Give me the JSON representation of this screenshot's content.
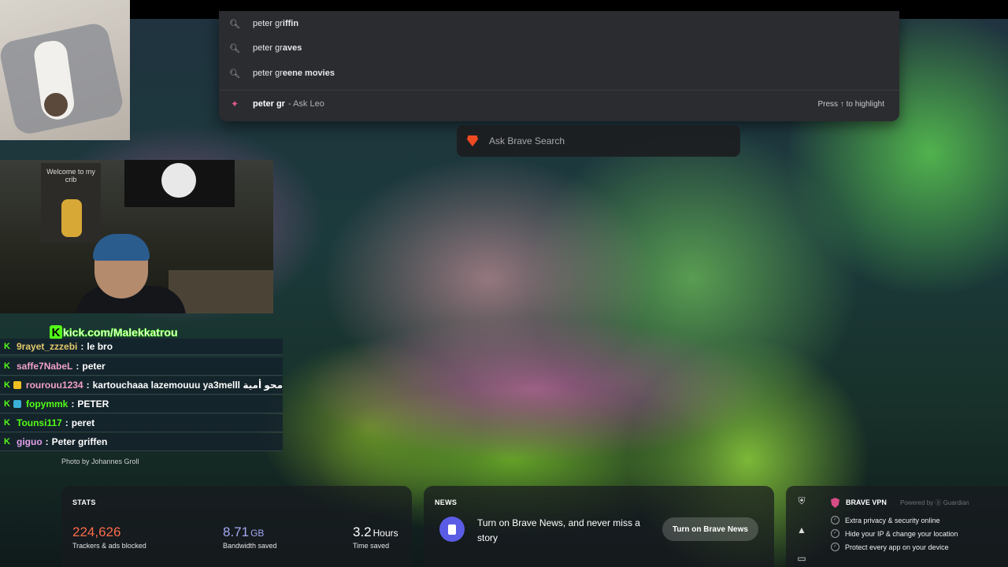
{
  "omnibox": {
    "suggestions": [
      {
        "typed": "peter gr",
        "rest": "iffin"
      },
      {
        "typed": "peter gr",
        "rest": "aves"
      },
      {
        "typed": "peter gr",
        "rest": "eene movies"
      }
    ],
    "leo": {
      "query": "peter gr",
      "source": "- Ask Leo",
      "hint": "Press ↑ to highlight"
    }
  },
  "search": {
    "placeholder": "Ask Brave Search"
  },
  "overlay": {
    "webcam_poster": "Welcome to my crib",
    "kick_url": "kick.com/Malekkatrou",
    "kick_letter": "K",
    "chat": [
      {
        "user": "9rayet_zzzebi",
        "text": "le bro",
        "color": "#e3c86a"
      },
      {
        "user": "saffe7NabeL",
        "text": "peter",
        "color": "#f1a0c8"
      },
      {
        "user": "rourouu1234",
        "text": "kartouchaaa lazemouuu ya3melll محو أمية",
        "color": "#f1a0c8",
        "badge": "#f0c020"
      },
      {
        "user": "fopymmk",
        "text": "PETER",
        "color": "#53fc18",
        "badge": "#3ab0d8"
      },
      {
        "user": "Tounsi117",
        "text": "peret",
        "color": "#53fc18"
      },
      {
        "user": "giguo",
        "text": "Peter griffen",
        "color": "#e0a0e8"
      }
    ]
  },
  "photo_credit": "Photo by Johannes Groll",
  "stats": {
    "title": "STATS",
    "trackers": {
      "value": "224,626",
      "label": "Trackers & ads blocked",
      "color": "#fb6b4a"
    },
    "bandwidth": {
      "value": "8.71",
      "unit": "GB",
      "label": "Bandwidth saved",
      "color": "#a5a8f5"
    },
    "time": {
      "value": "3.2",
      "unit": "Hours",
      "label": "Time saved",
      "color": "#ffffff"
    }
  },
  "news": {
    "title": "NEWS",
    "text": "Turn on Brave News, and never miss a story",
    "button": "Turn on Brave News"
  },
  "vpn": {
    "title": "BRAVE VPN",
    "powered": "Powered by ⓖ Guardian",
    "features": [
      "Extra privacy & security online",
      "Hide your IP & change your location",
      "Protect every app on your device"
    ]
  },
  "icons": {
    "suggestion": "search-icon",
    "leo": "leo-icon",
    "rail": [
      "shield-icon",
      "warning-icon",
      "camera-icon"
    ]
  }
}
